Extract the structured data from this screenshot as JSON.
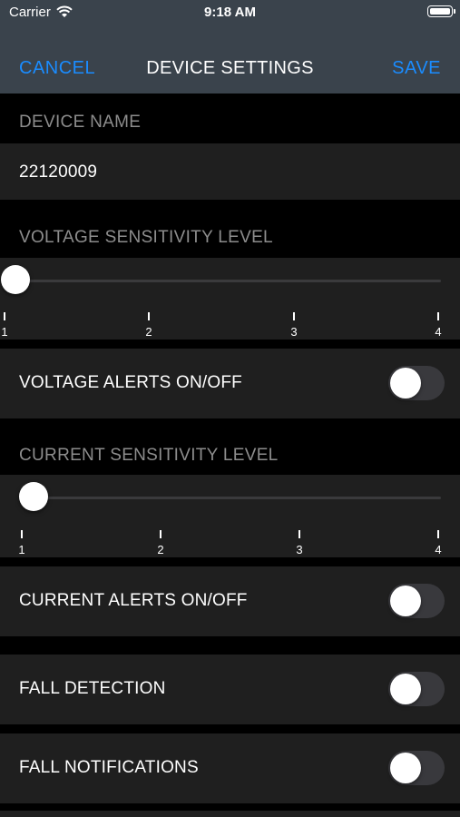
{
  "status_bar": {
    "carrier": "Carrier",
    "time": "9:18 AM"
  },
  "nav": {
    "cancel": "CANCEL",
    "title": "DEVICE SETTINGS",
    "save": "SAVE"
  },
  "device_name": {
    "header": "DEVICE NAME",
    "value": "22120009"
  },
  "voltage_sensitivity": {
    "header": "VOLTAGE SENSITIVITY LEVEL",
    "value": 1,
    "ticks": [
      "1",
      "2",
      "3",
      "4"
    ]
  },
  "voltage_alerts": {
    "label": "VOLTAGE ALERTS ON/OFF",
    "on": false
  },
  "current_sensitivity": {
    "header": "CURRENT SENSITIVITY LEVEL",
    "value": 1,
    "ticks": [
      "1",
      "2",
      "3",
      "4"
    ]
  },
  "current_alerts": {
    "label": "CURRENT ALERTS ON/OFF",
    "on": false
  },
  "fall_detection": {
    "label": "FALL DETECTION",
    "on": false
  },
  "fall_notifications": {
    "label": "FALL NOTIFICATIONS",
    "on": false
  },
  "colors": {
    "accent": "#1a8cff",
    "nav_background": "#3a434c",
    "cell_background": "#1f1f1f",
    "header_text": "#8d8d8d"
  }
}
